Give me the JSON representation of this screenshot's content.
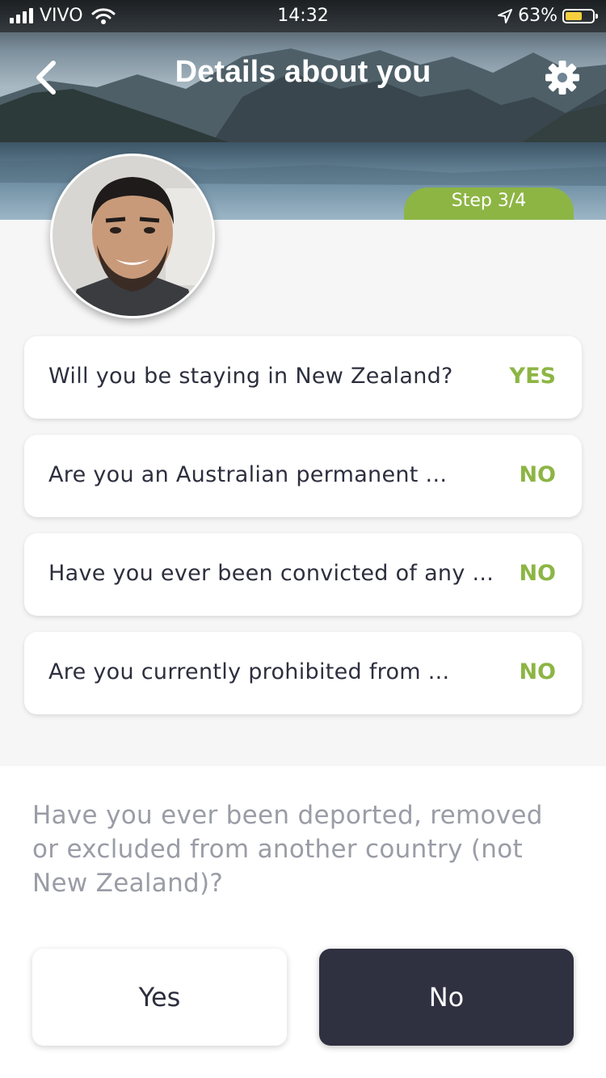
{
  "status_bar": {
    "carrier": "VIVO",
    "time": "14:32",
    "battery": "63%",
    "battery_level": 0.63
  },
  "header": {
    "title": "Details about you",
    "step": "Step 3/4"
  },
  "questions": [
    {
      "text": "Will you be staying in New Zealand?",
      "answer": "YES"
    },
    {
      "text": "Are you an Australian permanent ...",
      "answer": "NO"
    },
    {
      "text": "Have you ever been convicted of any ...",
      "answer": "NO"
    },
    {
      "text": "Are you currently prohibited from ...",
      "answer": "NO"
    }
  ],
  "current_question": {
    "text": "Have you ever been deported, removed or excluded from another country (not New Zealand)?"
  },
  "buttons": {
    "yes": "Yes",
    "no": "No"
  },
  "colors": {
    "accent_green": "#8db544",
    "dark_button": "#2f3040"
  },
  "icons": [
    "signal-icon",
    "wifi-icon",
    "location-arrow-icon",
    "battery-icon",
    "back-chevron-icon",
    "gear-icon"
  ]
}
